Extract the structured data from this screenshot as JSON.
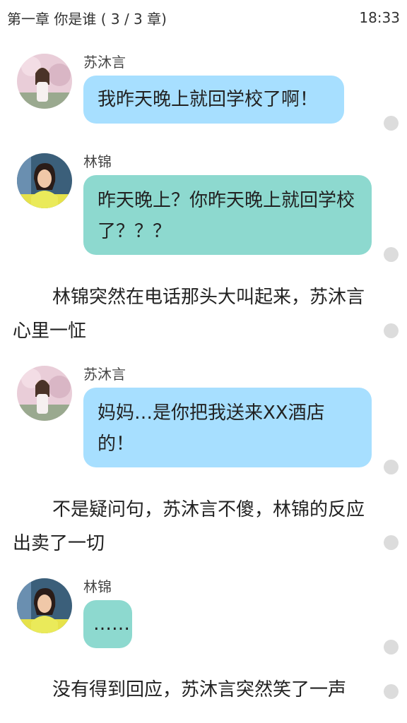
{
  "status": {
    "chapter": "第一章 你是谁 ( 3 / 3 章)",
    "time": "18:33"
  },
  "messages": [
    {
      "sender": "苏沐言",
      "text": "我昨天晚上就回学校了啊！"
    },
    {
      "sender": "林锦",
      "text": "昨天晚上？你昨天晚上就回学校了？？？"
    },
    {
      "sender": "苏沐言",
      "text": "妈妈…是你把我送来XX酒店的！"
    },
    {
      "sender": "林锦",
      "text": "……"
    }
  ],
  "narration": [
    "林锦突然在电话那头大叫起来，苏沐言心里一怔",
    "不是疑问句，苏沐言不傻，林锦的反应出卖了一切",
    "没有得到回应，苏沐言突然笑了一声"
  ],
  "colors": {
    "bubble_su": "#a7dfff",
    "bubble_lin": "#8dd9cf",
    "dot": "#dcdcdc"
  }
}
